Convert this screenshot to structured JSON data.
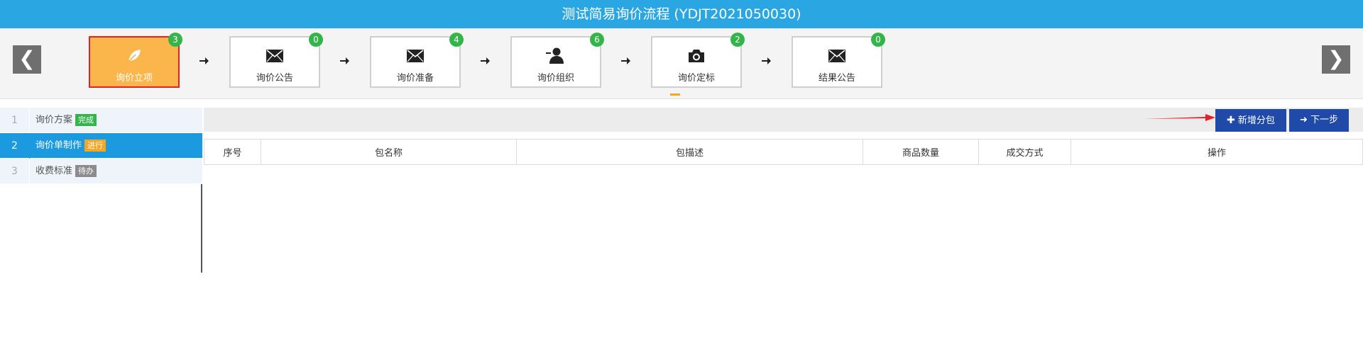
{
  "title": "测试简易询价流程 (YDJT2021050030)",
  "nav": {
    "prev": "❮",
    "next": "❯"
  },
  "steps": [
    {
      "label": "询价立项",
      "badge": "3",
      "icon": "leaf-icon"
    },
    {
      "label": "询价公告",
      "badge": "0",
      "icon": "envelope-icon"
    },
    {
      "label": "询价准备",
      "badge": "4",
      "icon": "envelope-icon"
    },
    {
      "label": "询价组织",
      "badge": "6",
      "icon": "user-icon"
    },
    {
      "label": "询价定标",
      "badge": "2",
      "icon": "camera-icon"
    },
    {
      "label": "结果公告",
      "badge": "0",
      "icon": "envelope-icon"
    }
  ],
  "menu": [
    {
      "num": "1",
      "label": "询价方案",
      "tag": "完成",
      "tag_color": "#33b54a"
    },
    {
      "num": "2",
      "label": "询价单制作",
      "tag": "进行",
      "tag_color": "#f5a623"
    },
    {
      "num": "3",
      "label": "收费标准",
      "tag": "待办",
      "tag_color": "#8c8c8c"
    }
  ],
  "toolbar": {
    "add_label": "新增分包",
    "next_label": "下一步"
  },
  "table": {
    "columns": [
      "序号",
      "包名称",
      "包描述",
      "商品数量",
      "成交方式",
      "操作"
    ]
  },
  "colors": {
    "header": "#2aa7e2",
    "active_step": "#fbb64b",
    "badge": "#33b54a",
    "button": "#1f4aa8",
    "active_menu": "#1b9ae0"
  }
}
